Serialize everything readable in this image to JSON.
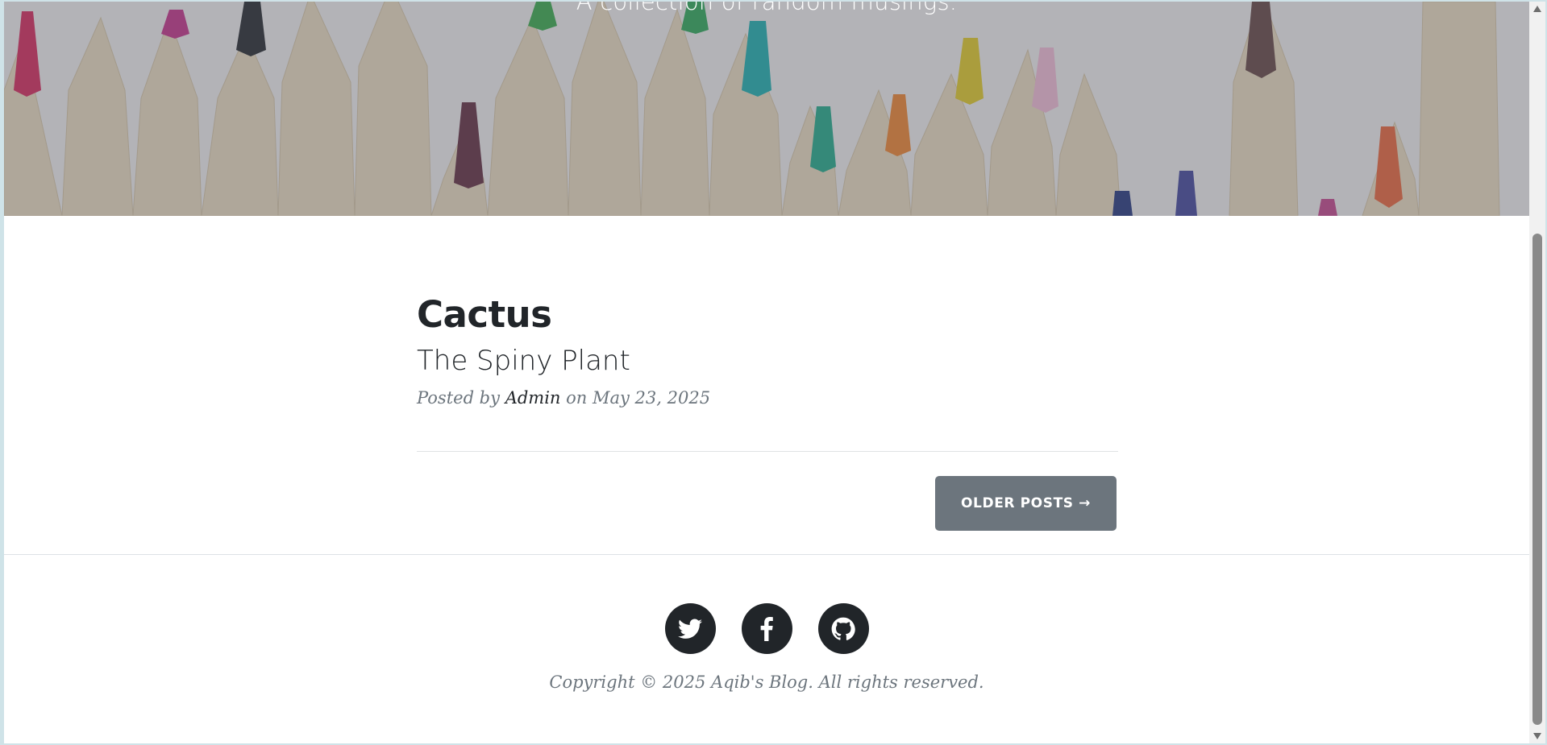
{
  "masthead": {
    "subheading": "A collection of random musings."
  },
  "post": {
    "title": "Cactus",
    "subtitle": "The Spiny Plant",
    "meta_prefix": "Posted by",
    "author": "Admin",
    "meta_on": "on",
    "date": "May 23, 2025"
  },
  "pager": {
    "older_label": "OLDER POSTS →"
  },
  "footer": {
    "social": [
      {
        "name": "twitter-icon"
      },
      {
        "name": "facebook-icon"
      },
      {
        "name": "github-icon"
      }
    ],
    "copyright": "Copyright © 2025 Aqib's Blog. All rights reserved."
  },
  "colors": {
    "button": "#6c757d",
    "text_dark": "#212529",
    "meta": "#6c757d"
  }
}
